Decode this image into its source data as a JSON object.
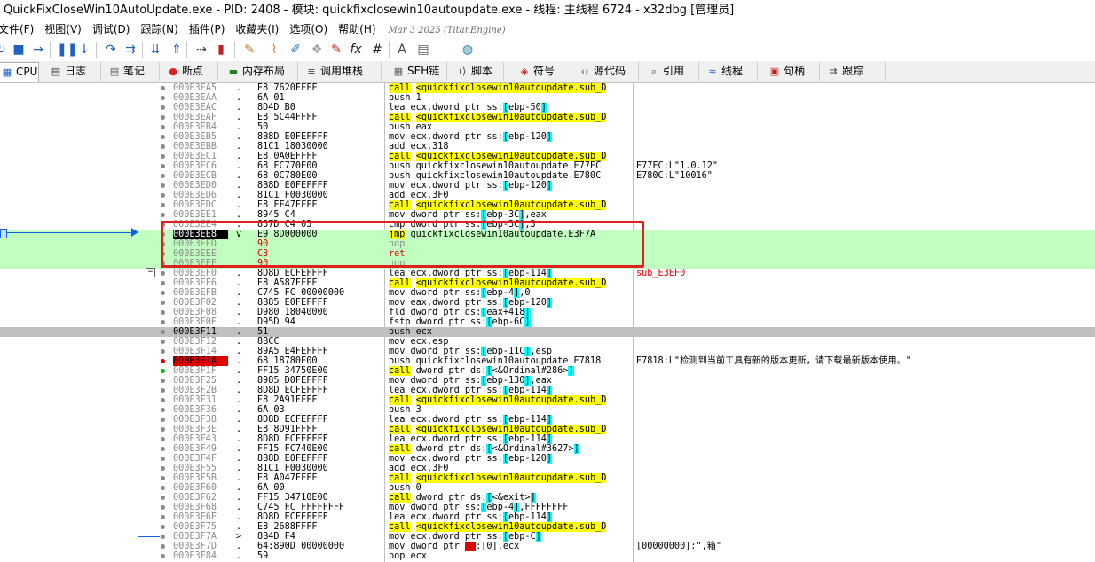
{
  "window": {
    "title": "QuickFixCloseWin10AutoUpdate.exe - PID: 2408 - 模块: quickfixclosewin10autoupdate.exe - 线程: 主线程 6724 - x32dbg [管理员]"
  },
  "menu": {
    "items": [
      "文件(F)",
      "视图(V)",
      "调试(D)",
      "跟踪(N)",
      "插件(P)",
      "收藏夹(I)",
      "选项(O)",
      "帮助(H)"
    ],
    "date": "Mar 3 2025 (TitanEngine)"
  },
  "toolbar": {
    "icons": [
      {
        "name": "restart-icon",
        "glyph": "↻",
        "color": "#2060c0"
      },
      {
        "name": "stop-icon",
        "glyph": "■",
        "color": "#2060c0"
      },
      {
        "name": "run-icon",
        "glyph": "→",
        "color": "#2060c0"
      },
      {
        "name": "pause-icon",
        "glyph": "❚❚",
        "color": "#2060c0"
      },
      {
        "name": "step-into-icon",
        "glyph": "↓",
        "color": "#2060c0"
      },
      {
        "name": "step-over-icon",
        "glyph": "↷",
        "color": "#2060c0"
      },
      {
        "name": "trace-into-icon",
        "glyph": "⇉",
        "color": "#2060c0"
      },
      {
        "name": "trace-over-icon",
        "glyph": "⇊",
        "color": "#2060c0"
      },
      {
        "name": "execute-till-return-icon",
        "glyph": "⇑",
        "color": "#2060c0"
      },
      {
        "name": "run-to-user-code-icon",
        "glyph": "⇢",
        "color": "#404040"
      },
      {
        "name": "scylla-icon",
        "glyph": "▮",
        "color": "#c02020"
      },
      {
        "name": "patch-icon",
        "glyph": "✎",
        "color": "#d07020"
      },
      {
        "name": "comment-icon",
        "glyph": "⌇",
        "color": "#e08040"
      },
      {
        "name": "label-icon",
        "glyph": "✐",
        "color": "#2070c0"
      },
      {
        "name": "bookmark-icon",
        "glyph": "❖",
        "color": "#a0a0a0"
      },
      {
        "name": "function-icon",
        "glyph": "✎",
        "color": "#c02020"
      },
      {
        "name": "fx-icon",
        "glyph": "fx",
        "color": "#202020"
      },
      {
        "name": "hash-icon",
        "glyph": "#",
        "color": "#202020"
      },
      {
        "name": "font-icon",
        "glyph": "A",
        "color": "#404040"
      },
      {
        "name": "settings-icon",
        "glyph": "▤",
        "color": "#606060"
      },
      {
        "name": "memory-map-icon",
        "glyph": "◍",
        "color": "#2080a0"
      }
    ]
  },
  "tabs": [
    {
      "label": "CPU",
      "icon": "cpu-icon",
      "glyph": "▦",
      "color": "#2060c0"
    },
    {
      "label": "日志",
      "icon": "log-icon",
      "glyph": "▤",
      "color": "#404040"
    },
    {
      "label": "笔记",
      "icon": "notes-icon",
      "glyph": "▤",
      "color": "#606060"
    },
    {
      "label": "断点",
      "icon": "breakpoint-icon",
      "glyph": "●",
      "color": "#e02020"
    },
    {
      "label": "内存布局",
      "icon": "memory-map-icon",
      "glyph": "▬",
      "color": "#208020"
    },
    {
      "label": "调用堆栈",
      "icon": "call-stack-icon",
      "glyph": "≡",
      "color": "#404040"
    },
    {
      "label": "SEH链",
      "icon": "seh-icon",
      "glyph": "▦",
      "color": "#606060"
    },
    {
      "label": "脚本",
      "icon": "script-icon",
      "glyph": "⟨⟩",
      "color": "#404040"
    },
    {
      "label": "符号",
      "icon": "symbols-icon",
      "glyph": "◈",
      "color": "#c02020"
    },
    {
      "label": "源代码",
      "icon": "source-icon",
      "glyph": "‹›",
      "color": "#404040"
    },
    {
      "label": "引用",
      "icon": "references-icon",
      "glyph": "⌕",
      "color": "#404040"
    },
    {
      "label": "线程",
      "icon": "threads-icon",
      "glyph": "≈",
      "color": "#2060c0"
    },
    {
      "label": "句柄",
      "icon": "handles-icon",
      "glyph": "▣",
      "color": "#c02020"
    },
    {
      "label": "跟踪",
      "icon": "trace-icon",
      "glyph": "⇉",
      "color": "#404040"
    }
  ],
  "disassembly": [
    {
      "addr": "000E3EA5",
      "mk": ".",
      "bytes": "E8 7620FFFF",
      "type": "call",
      "op": "call",
      "arg": "<quickfixclosewin10autoupdate.sub_D",
      "cmt": ""
    },
    {
      "addr": "000E3EAA",
      "mk": ".",
      "bytes": "6A 01",
      "type": "plain",
      "asm": "push 1",
      "cmt": ""
    },
    {
      "addr": "000E3EAC",
      "mk": ".",
      "bytes": "8D4D B0",
      "type": "mem",
      "pre": "lea ecx,dword ptr ss:",
      "reg": "ebp-50",
      "post": "",
      "cmt": ""
    },
    {
      "addr": "000E3EAF",
      "mk": ".",
      "bytes": "E8 5C44FFFF",
      "type": "call",
      "op": "call",
      "arg": "<quickfixclosewin10autoupdate.sub_D",
      "cmt": ""
    },
    {
      "addr": "000E3EB4",
      "mk": ".",
      "bytes": "50",
      "type": "plain",
      "asm": "push eax",
      "cmt": ""
    },
    {
      "addr": "000E3EB5",
      "mk": ".",
      "bytes": "8B8D E0FEFFFF",
      "type": "mem",
      "pre": "mov ecx,dword ptr ss:",
      "reg": "ebp-120",
      "post": "",
      "cmt": ""
    },
    {
      "addr": "000E3EBB",
      "mk": ".",
      "bytes": "81C1 18030000",
      "type": "plain",
      "asm": "add ecx,318",
      "cmt": ""
    },
    {
      "addr": "000E3EC1",
      "mk": ".",
      "bytes": "E8 0A0EFFFF",
      "type": "call",
      "op": "call",
      "arg": "<quickfixclosewin10autoupdate.sub_D",
      "cmt": ""
    },
    {
      "addr": "000E3EC6",
      "mk": ".",
      "bytes": "68 FC770E00",
      "type": "plain",
      "asm": "push quickfixclosewin10autoupdate.E77FC",
      "cmt": "E77FC:L\"1.0.12\""
    },
    {
      "addr": "000E3ECB",
      "mk": ".",
      "bytes": "68 0C780E00",
      "type": "plain",
      "asm": "push quickfixclosewin10autoupdate.E780C",
      "cmt": "E780C:L\"10016\""
    },
    {
      "addr": "000E3ED0",
      "mk": ".",
      "bytes": "8B8D E0FEFFFF",
      "type": "mem",
      "pre": "mov ecx,dword ptr ss:",
      "reg": "ebp-120",
      "post": "",
      "cmt": ""
    },
    {
      "addr": "000E3ED6",
      "mk": ".",
      "bytes": "81C1 F0030000",
      "type": "plain",
      "asm": "add ecx,3F0",
      "cmt": ""
    },
    {
      "addr": "000E3EDC",
      "mk": ".",
      "bytes": "E8 FF47FFFF",
      "type": "call",
      "op": "call",
      "arg": "<quickfixclosewin10autoupdate.sub_D",
      "cmt": ""
    },
    {
      "addr": "000E3EE1",
      "mk": ".",
      "bytes": "8945 C4",
      "type": "mem",
      "pre": "mov dword ptr ss:",
      "reg": "ebp-3C",
      "post": ",eax",
      "cmt": ""
    },
    {
      "addr": "000E3EE4",
      "mk": ".",
      "bytes": "837D C4 03",
      "type": "mem",
      "pre": "cmp dword ptr ss:",
      "reg": "ebp-3C",
      "post": ",3",
      "cmt": ""
    },
    {
      "addr": "000E3EE8",
      "mk": "v",
      "bytes": "E9 8D000000",
      "type": "jmp",
      "op": "jmp",
      "arg": "quickfixclosewin10autoupdate.E3F7A",
      "cmt": "",
      "sel": true,
      "eip": true
    },
    {
      "addr": "000E3EED",
      "mk": "",
      "bytes": "90",
      "type": "nop",
      "asm": "nop",
      "cmt": "",
      "sel": true,
      "red": true
    },
    {
      "addr": "000E3EEE",
      "mk": "",
      "bytes": "C3",
      "type": "ret",
      "asm": "ret",
      "cmt": "",
      "sel": true,
      "red": true
    },
    {
      "addr": "000E3EEF",
      "mk": "",
      "bytes": "90",
      "type": "nop",
      "asm": "nop",
      "cmt": "",
      "sel": true,
      "red": true
    },
    {
      "addr": "000E3EF0",
      "mk": ".",
      "bytes": "8D8D ECFEFFFF",
      "type": "mem",
      "pre": "lea ecx,dword ptr ss:",
      "reg": "ebp-114",
      "post": "",
      "cmt": "sub_E3EF0",
      "cmtred": true
    },
    {
      "addr": "000E3EF6",
      "mk": ".",
      "bytes": "E8 A587FFFF",
      "type": "call",
      "op": "call",
      "arg": "<quickfixclosewin10autoupdate.sub_D",
      "cmt": ""
    },
    {
      "addr": "000E3EFB",
      "mk": ".",
      "bytes": "C745 FC 00000000",
      "type": "mem",
      "pre": "mov dword ptr ss:",
      "reg": "ebp-4",
      "post": ",0",
      "cmt": ""
    },
    {
      "addr": "000E3F02",
      "mk": ".",
      "bytes": "8B85 E0FEFFFF",
      "type": "mem",
      "pre": "mov eax,dword ptr ss:",
      "reg": "ebp-120",
      "post": "",
      "cmt": ""
    },
    {
      "addr": "000E3F08",
      "mk": ".",
      "bytes": "D980 18040000",
      "type": "mem",
      "pre": "fld dword ptr ds:",
      "reg": "eax+418",
      "post": "",
      "cmt": ""
    },
    {
      "addr": "000E3F0E",
      "mk": ".",
      "bytes": "D95D 94",
      "type": "mem",
      "pre": "fstp dword ptr ss:",
      "reg": "ebp-6C",
      "post": "",
      "cmt": ""
    },
    {
      "addr": "000E3F11",
      "mk": ".",
      "bytes": "51",
      "type": "plain",
      "asm": "push ecx",
      "cmt": "",
      "cur": true
    },
    {
      "addr": "000E3F12",
      "mk": ".",
      "bytes": "8BCC",
      "type": "plain",
      "asm": "mov ecx,esp",
      "cmt": ""
    },
    {
      "addr": "000E3F14",
      "mk": ".",
      "bytes": "89A5 E4FEFFFF",
      "type": "mem",
      "pre": "mov dword ptr ss:",
      "reg": "ebp-11C",
      "post": ",esp",
      "cmt": ""
    },
    {
      "addr": "000E3F1A",
      "mk": ".",
      "bytes": "68 18780E00",
      "type": "plain",
      "asm": "push quickfixclosewin10autoupdate.E7818",
      "cmt": "E7818:L\"检测到当前工具有新的版本更新，请下载最新版本使用。\"",
      "bp": true
    },
    {
      "addr": "000E3F1F",
      "mk": ".",
      "bytes": "FF15 34750E00",
      "type": "callmem",
      "pre": "call dword ptr ds:",
      "reg": "<&Ordinal#286>",
      "post": "",
      "cmt": ""
    },
    {
      "addr": "000E3F25",
      "mk": ".",
      "bytes": "8985 D0FEFFFF",
      "type": "mem",
      "pre": "mov dword ptr ss:",
      "reg": "ebp-130",
      "post": ",eax",
      "cmt": ""
    },
    {
      "addr": "000E3F2B",
      "mk": ".",
      "bytes": "8D8D ECFEFFFF",
      "type": "mem",
      "pre": "lea ecx,dword ptr ss:",
      "reg": "ebp-114",
      "post": "",
      "cmt": ""
    },
    {
      "addr": "000E3F31",
      "mk": ".",
      "bytes": "E8 2A91FFFF",
      "type": "call",
      "op": "call",
      "arg": "<quickfixclosewin10autoupdate.sub_D",
      "cmt": ""
    },
    {
      "addr": "000E3F36",
      "mk": ".",
      "bytes": "6A 03",
      "type": "plain",
      "asm": "push 3",
      "cmt": ""
    },
    {
      "addr": "000E3F38",
      "mk": ".",
      "bytes": "8D8D ECFEFFFF",
      "type": "mem",
      "pre": "lea ecx,dword ptr ss:",
      "reg": "ebp-114",
      "post": "",
      "cmt": ""
    },
    {
      "addr": "000E3F3E",
      "mk": ".",
      "bytes": "E8 8D91FFFF",
      "type": "call",
      "op": "call",
      "arg": "<quickfixclosewin10autoupdate.sub_D",
      "cmt": ""
    },
    {
      "addr": "000E3F43",
      "mk": ".",
      "bytes": "8D8D ECFEFFFF",
      "type": "mem",
      "pre": "lea ecx,dword ptr ss:",
      "reg": "ebp-114",
      "post": "",
      "cmt": ""
    },
    {
      "addr": "000E3F49",
      "mk": ".",
      "bytes": "FF15 FC740E00",
      "type": "callmem",
      "pre": "call dword ptr ds:",
      "reg": "<&Ordinal#3627>",
      "post": "",
      "cmt": ""
    },
    {
      "addr": "000E3F4F",
      "mk": ".",
      "bytes": "8B8D E0FEFFFF",
      "type": "mem",
      "pre": "mov ecx,dword ptr ss:",
      "reg": "ebp-120",
      "post": "",
      "cmt": ""
    },
    {
      "addr": "000E3F55",
      "mk": ".",
      "bytes": "81C1 F0030000",
      "type": "plain",
      "asm": "add ecx,3F0",
      "cmt": ""
    },
    {
      "addr": "000E3F5B",
      "mk": ".",
      "bytes": "E8 A047FFFF",
      "type": "call",
      "op": "call",
      "arg": "<quickfixclosewin10autoupdate.sub_D",
      "cmt": ""
    },
    {
      "addr": "000E3F60",
      "mk": ".",
      "bytes": "6A 00",
      "type": "plain",
      "asm": "push 0",
      "cmt": ""
    },
    {
      "addr": "000E3F62",
      "mk": ".",
      "bytes": "FF15 34710E00",
      "type": "callmem",
      "pre": "call dword ptr ds:",
      "reg": "<&exit>",
      "post": "",
      "cmt": ""
    },
    {
      "addr": "000E3F68",
      "mk": ".",
      "bytes": "C745 FC FFFFFFFF",
      "type": "mem",
      "pre": "mov dword ptr ss:",
      "reg": "ebp-4",
      "post": ",FFFFFFFF",
      "cmt": ""
    },
    {
      "addr": "000E3F6F",
      "mk": ".",
      "bytes": "8D8D ECFEFFFF",
      "type": "mem",
      "pre": "lea ecx,dword ptr ss:",
      "reg": "ebp-114",
      "post": "",
      "cmt": ""
    },
    {
      "addr": "000E3F75",
      "mk": ".",
      "bytes": "E8 2688FFFF",
      "type": "call",
      "op": "call",
      "arg": "<quickfixclosewin10autoupdate.sub_D",
      "cmt": ""
    },
    {
      "addr": "000E3F7A",
      "mk": ">",
      "bytes": "8B4D F4",
      "type": "mem",
      "pre": "mov ecx,dword ptr ss:",
      "reg": "ebp-C",
      "post": "",
      "cmt": ""
    },
    {
      "addr": "000E3F7D",
      "mk": ".",
      "bytes": "64:890D 00000000",
      "type": "mem",
      "pre": "mov dword ptr ",
      "reg": "fs",
      "post": ":[0],ecx",
      "cmt": "[00000000]:\",箱\"",
      "fsred": true
    },
    {
      "addr": "000E3F84",
      "mk": ".",
      "bytes": "59",
      "type": "plain",
      "asm": "pop ecx",
      "cmt": ""
    }
  ],
  "colors": {
    "highlight_green": "#c0ffc0",
    "call_yellow": "#ffff00",
    "bracket_cyan": "#00ffff",
    "breakpoint_red": "#e00000",
    "annotation_box": "#e02020",
    "jump_arrow": "#1060e0"
  }
}
